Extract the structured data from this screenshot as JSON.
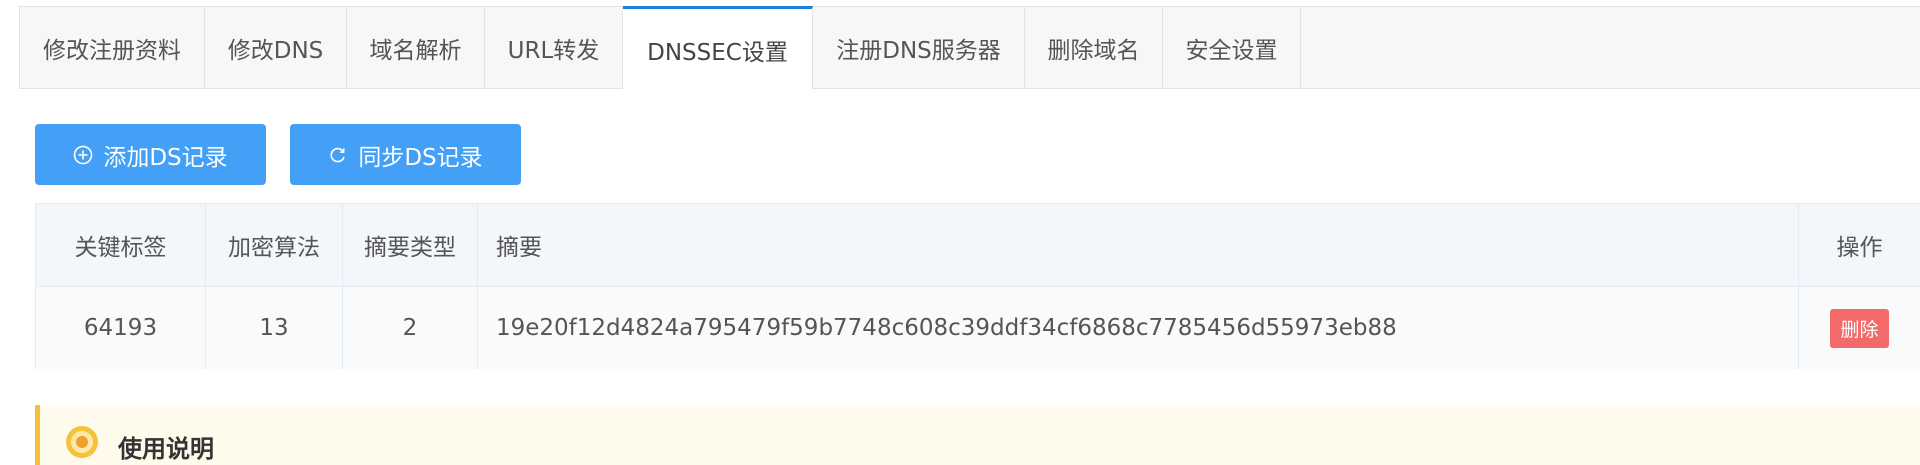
{
  "tabs": [
    {
      "label": "修改注册资料"
    },
    {
      "label": "修改DNS"
    },
    {
      "label": "域名解析"
    },
    {
      "label": "URL转发"
    },
    {
      "label": "DNSSEC设置"
    },
    {
      "label": "注册DNS服务器"
    },
    {
      "label": "删除域名"
    },
    {
      "label": "安全设置"
    }
  ],
  "active_tab": "DNSSEC设置",
  "toolbar": {
    "add_label": "添加DS记录",
    "sync_label": "同步DS记录"
  },
  "table": {
    "headers": [
      "关键标签",
      "加密算法",
      "摘要类型",
      "摘要",
      "操作"
    ],
    "rows": [
      {
        "key_tag": "64193",
        "algorithm": "13",
        "digest_type": "2",
        "digest": "19e20f12d4824a795479f59b7748c608c39ddf34cf6868c7785456d55973eb88",
        "action_label": "删除"
      }
    ]
  },
  "notice": {
    "title": "使用说明"
  },
  "colors": {
    "accent": "#1d81d8",
    "button": "#43a0f6",
    "danger": "#f26a6a",
    "notice_bar": "#f6c23e"
  }
}
